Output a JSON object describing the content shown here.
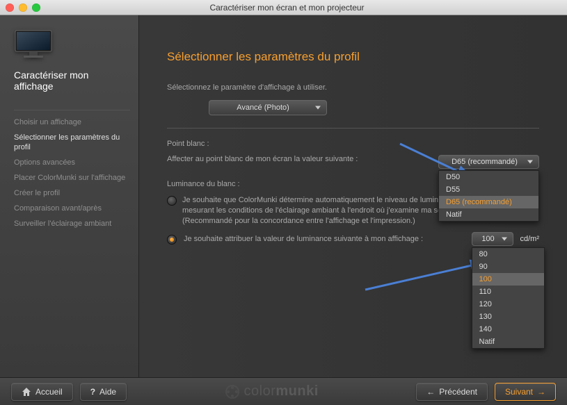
{
  "window": {
    "title": "Caractériser mon écran et mon projecteur"
  },
  "sidebar": {
    "title": "Caractériser mon affichage",
    "items": [
      "Choisir un affichage",
      "Sélectionner les paramètres du profil",
      "Options avancées",
      "Placer ColorMunki sur l'affichage",
      "Créer le profil",
      "Comparaison avant/après",
      "Surveiller l'éclairage ambiant"
    ]
  },
  "main": {
    "heading": "Sélectionner les paramètres du profil",
    "instruction": "Sélectionnez le paramètre d'affichage à utiliser.",
    "mode_value": "Avancé (Photo)",
    "whitepoint_label": "Point blanc :",
    "whitepoint_text": "Affecter au point blanc de mon écran la valeur suivante :",
    "whitepoint_value": "D65 (recommandé)",
    "whitepoint_options": [
      "D50",
      "D55",
      "D65 (recommandé)",
      "Natif"
    ],
    "luminance_label": "Luminance du blanc :",
    "radio_auto": "Je souhaite que ColorMunki détermine automatiquement le niveau de luminance de mon affichage en mesurant les conditions de l'éclairage ambiant à l'endroit où j'examine ma sortie imprimée.  (Recommandé pour la concordance entre l'affichage et l'impression.)",
    "radio_manual": "Je souhaite attribuer la valeur de luminance suivante à mon affichage :",
    "luminance_value": "100",
    "luminance_unit": "cd/m²",
    "luminance_options": [
      "80",
      "90",
      "100",
      "110",
      "120",
      "130",
      "140",
      "Natif"
    ]
  },
  "footer": {
    "home": "Accueil",
    "help": "Aide",
    "brand1": "color",
    "brand2": "munki",
    "prev": "Précédent",
    "next": "Suivant"
  }
}
